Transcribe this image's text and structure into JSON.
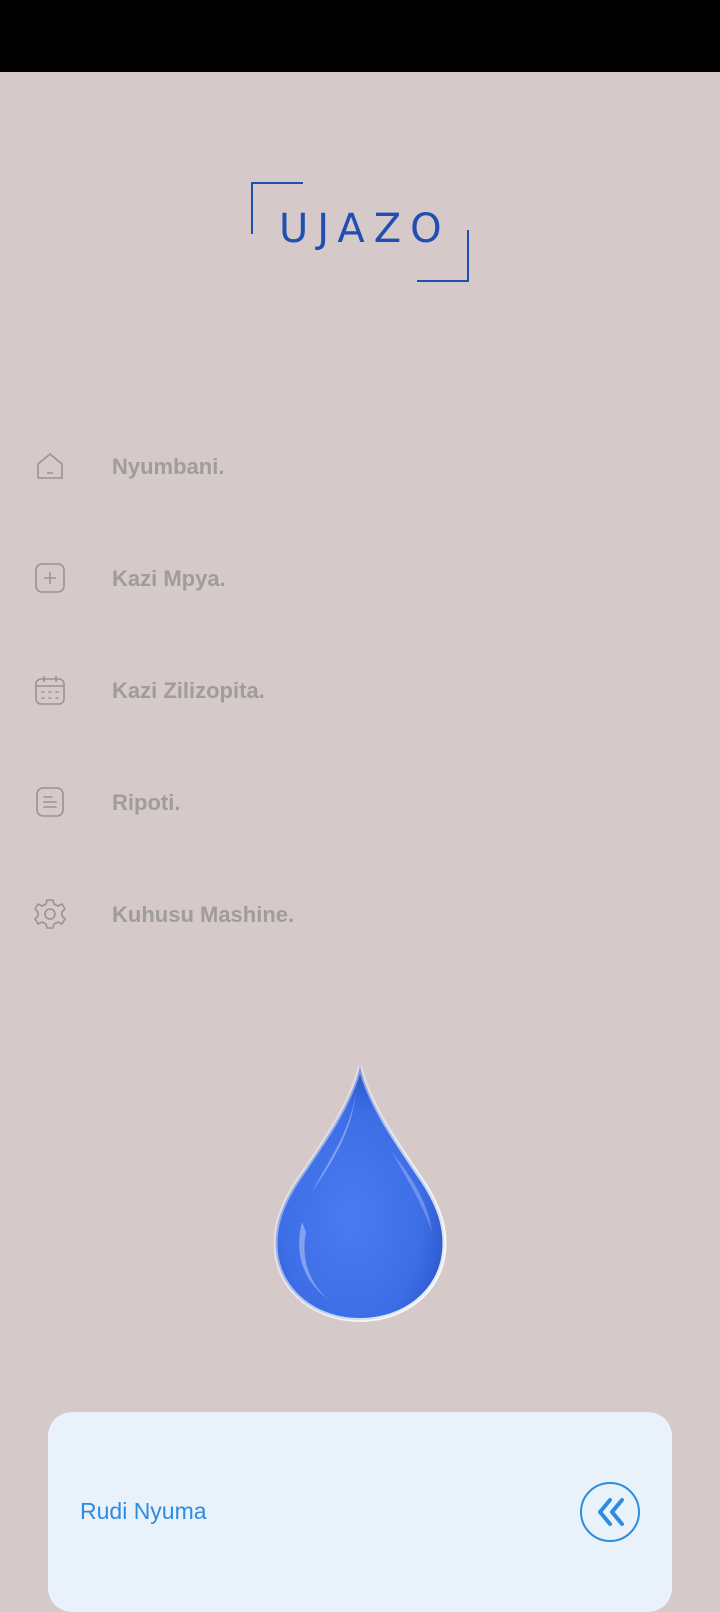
{
  "app": {
    "logo_text": "UJAZO",
    "brand_color": "#1f4fb3",
    "accent_color": "#2d8be0",
    "background_color": "#d5c9c9"
  },
  "menu": {
    "items": [
      {
        "label": "Nyumbani.",
        "icon": "home-icon"
      },
      {
        "label": "Kazi Mpya.",
        "icon": "plus-square-icon"
      },
      {
        "label": "Kazi Zilizopita.",
        "icon": "calendar-icon"
      },
      {
        "label": "Ripoti.",
        "icon": "document-icon"
      },
      {
        "label": "Kuhusu Mashine.",
        "icon": "gear-icon"
      }
    ]
  },
  "illustration": {
    "icon": "water-drop-icon"
  },
  "back_card": {
    "label": "Rudi Nyuma",
    "icon": "double-chevron-left-icon"
  }
}
